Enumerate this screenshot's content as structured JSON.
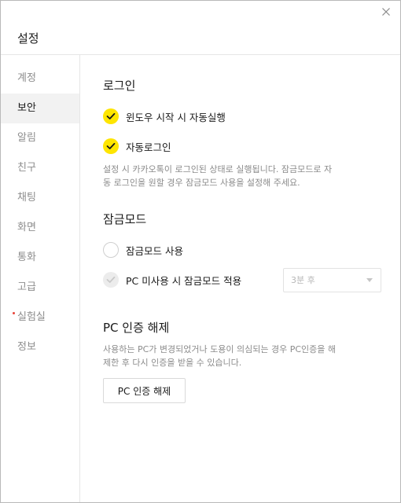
{
  "window": {
    "title": "설정",
    "close_icon": "close-icon"
  },
  "sidebar": {
    "items": [
      {
        "label": "계정",
        "active": false
      },
      {
        "label": "보안",
        "active": true
      },
      {
        "label": "알림",
        "active": false
      },
      {
        "label": "친구",
        "active": false
      },
      {
        "label": "채팅",
        "active": false
      },
      {
        "label": "화면",
        "active": false
      },
      {
        "label": "통화",
        "active": false
      },
      {
        "label": "고급",
        "active": false
      },
      {
        "label": "실험실",
        "active": false,
        "badge_dot": true
      },
      {
        "label": "정보",
        "active": false
      }
    ]
  },
  "login": {
    "title": "로그인",
    "autostart_label": "윈도우 시작 시 자동실행",
    "autostart_checked": true,
    "autologin_label": "자동로그인",
    "autologin_checked": true,
    "description_line1": "설정 시 카카오톡이 로그인된 상태로 실행됩니다. 잠금모드로 자",
    "description_line2": "동 로그인을 원할 경우 잠금모드 사용을 설정해 주세요."
  },
  "lockmode": {
    "title": "잠금모드",
    "use_label": "잠금모드 사용",
    "use_checked": false,
    "idle_label": "PC 미사용 시 잠금모드 적용",
    "idle_enabled": false,
    "idle_select_value": "3분 후"
  },
  "pc_auth": {
    "title": "PC 인증 해제",
    "description_line1": "사용하는 PC가 변경되었거나 도용이 의심되는 경우 PC인증을 해",
    "description_line2": "제한 후 다시 인증을 받을 수 있습니다.",
    "button_label": "PC 인증 해제"
  },
  "colors": {
    "accent": "#fee500",
    "check_mark": "#1a1a1a",
    "active_nav_bg": "#f2f2f2",
    "lab_dot": "#e8443a"
  }
}
